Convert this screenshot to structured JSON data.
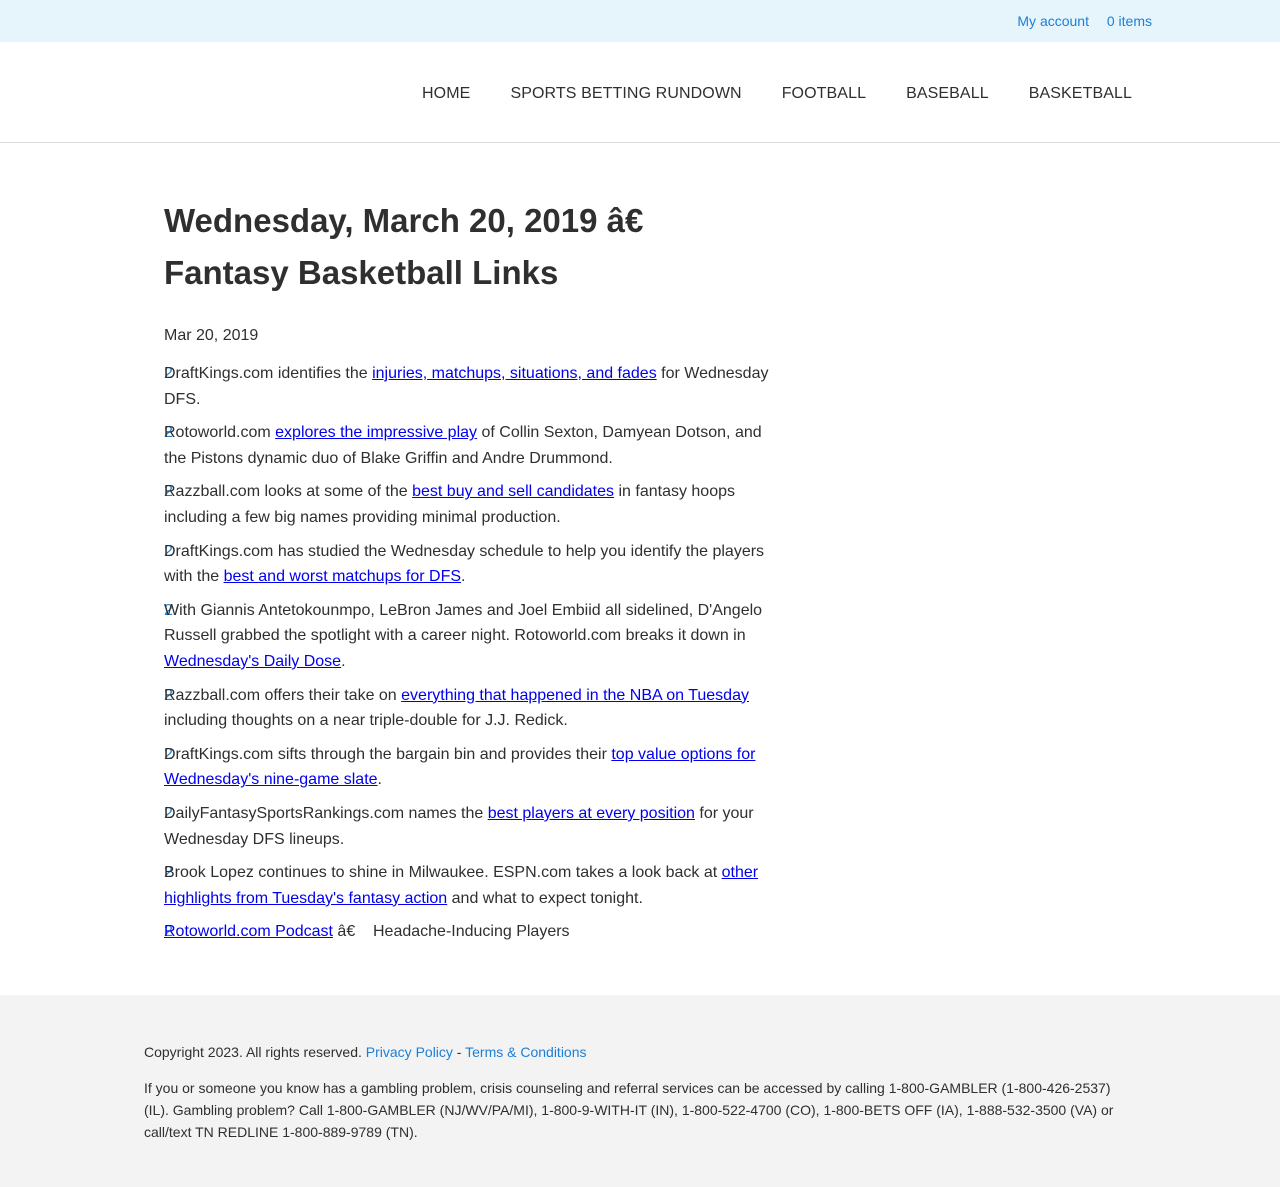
{
  "topbar": {
    "account_label": "My account",
    "cart_label": "0 items"
  },
  "nav": {
    "items": [
      "HOME",
      "SPORTS BETTING RUNDOWN",
      "FOOTBALL",
      "BASEBALL",
      "BASKETBALL"
    ]
  },
  "article": {
    "title": "Wednesday, March 20, 2019 â€ Fantasy Basketball Links",
    "date": "Mar 20, 2019",
    "bullet_glyphs": [
      "2",
      "2",
      "2",
      "2",
      "2",
      "2",
      "2",
      "2",
      "2",
      "2"
    ],
    "items": [
      {
        "before": "DraftKings.com identifies the ",
        "link": "injuries, matchups, situations, and fades",
        "after": " for Wednesday DFS."
      },
      {
        "before": "Rotoworld.com ",
        "link": "explores the impressive play",
        "after": " of Collin Sexton, Damyean Dotson, and the Pistons dynamic duo of Blake Griffin and Andre Drummond."
      },
      {
        "before": "Razzball.com looks at some of the ",
        "link": "best buy and sell candidates",
        "after": " in fantasy hoops including a few big names providing minimal production."
      },
      {
        "before": "DraftKings.com has studied the Wednesday schedule to help you identify the players with the ",
        "link": "best and worst matchups for DFS",
        "after": "."
      },
      {
        "before": "With Giannis Antetokounmpo, LeBron James and Joel Embiid all sidelined, D'Angelo Russell grabbed the spotlight with a career night. Rotoworld.com breaks it down in ",
        "link": "Wednesday's Daily Dose",
        "after": "."
      },
      {
        "before": "Razzball.com offers their take on ",
        "link": "everything that happened in the NBA on Tuesday",
        "after": " including thoughts on a near triple-double for J.J. Redick."
      },
      {
        "before": "DraftKings.com sifts through the bargain bin and provides their ",
        "link": "top value options for Wednesday's nine-game slate",
        "after": "."
      },
      {
        "before": "DailyFantasySportsRankings.com names the ",
        "link": "best players at every position",
        "after": " for your Wednesday DFS lineups."
      },
      {
        "before": "Brook Lopez continues to shine in Milwaukee. ESPN.com takes a look back at ",
        "link": "other highlights from Tuesday's fantasy action",
        "after": " and what to expect tonight."
      },
      {
        "before": "",
        "link": "Rotoworld.com Podcast",
        "after": " â€    Headache-Inducing Players"
      }
    ]
  },
  "footer": {
    "copyright": "Copyright 2023. All rights reserved. ",
    "privacy_label": "Privacy Policy",
    "separator": " - ",
    "terms_label": "Terms & Conditions",
    "disclaimer": "If you or someone you know has a gambling problem, crisis counseling and referral services can be accessed by calling 1-800-GAMBLER (1-800-426-2537) (IL). Gambling problem? Call 1-800-GAMBLER (NJ/WV/PA/MI), 1-800-9-WITH-IT (IN), 1-800-522-4700 (CO), 1-800-BETS OFF (IA), 1-888-532-3500 (VA) or call/text TN REDLINE 1-800-889-9789 (TN)."
  },
  "colors": {
    "topbar_bg": "#e6f4fc",
    "accent_link": "#1b7fd6",
    "article_link": "#0000ee",
    "footer_bg": "#f3f3f3",
    "text": "#2f2f2f"
  }
}
